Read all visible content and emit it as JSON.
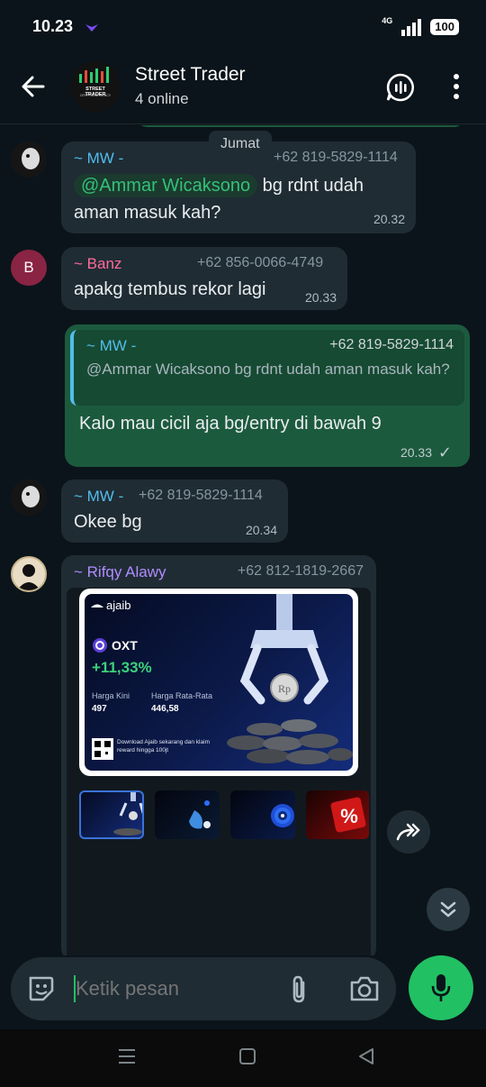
{
  "status_bar": {
    "time": "10.23",
    "network": "4G",
    "battery": "100"
  },
  "header": {
    "title": "Street Trader",
    "status": "4 online",
    "avatar_text": "STREET TRADER",
    "avatar_subtext": "CRYPTOCURRENCY"
  },
  "chat": {
    "day_chip": "Jumat",
    "messages": [
      {
        "sender": "~ MW -",
        "phone": "+62 819-5829-1114",
        "mention": "@Ammar Wicaksono",
        "text_after_mention": " bg rdnt udah",
        "text_line2": "aman masuk kah?",
        "time": "20.32"
      },
      {
        "sender": "~ Banz",
        "phone": "+62 856-0066-4749",
        "avatar_letter": "B",
        "text": "apakg tembus rekor lagi",
        "time": "20.33"
      },
      {
        "quote_sender": "~ MW -",
        "quote_phone": "+62 819-5829-1114",
        "quote_text": "@Ammar Wicaksono bg rdnt udah aman masuk kah?",
        "text": "Kalo mau cicil aja bg/entry di bawah 9",
        "time": "20.33",
        "tick": "✓"
      },
      {
        "sender": "~ MW -",
        "phone": "+62 819-5829-1114",
        "text": "Okee bg",
        "time": "20.34"
      },
      {
        "sender": "~ Rifqy Alawy",
        "phone": "+62 812-1819-2667"
      }
    ],
    "promo": {
      "brand": "ajaib",
      "coin": "OXT",
      "change": "+11,33%",
      "price_label": "Harga Kini",
      "price_value": "497",
      "avg_label": "Harga Rata-Rata",
      "avg_value": "446,58",
      "footer": "Download Ajaib sekarang dan klaim reward hingga 100jt",
      "coin_mark": "Rp"
    }
  },
  "input": {
    "placeholder": "Ketik pesan"
  },
  "colors": {
    "accent": "#21c063",
    "mention": "#34c07a",
    "mw_name": "#53bdeb",
    "banz_name": "#ff6b9a",
    "rifqy_name": "#b08cff"
  }
}
